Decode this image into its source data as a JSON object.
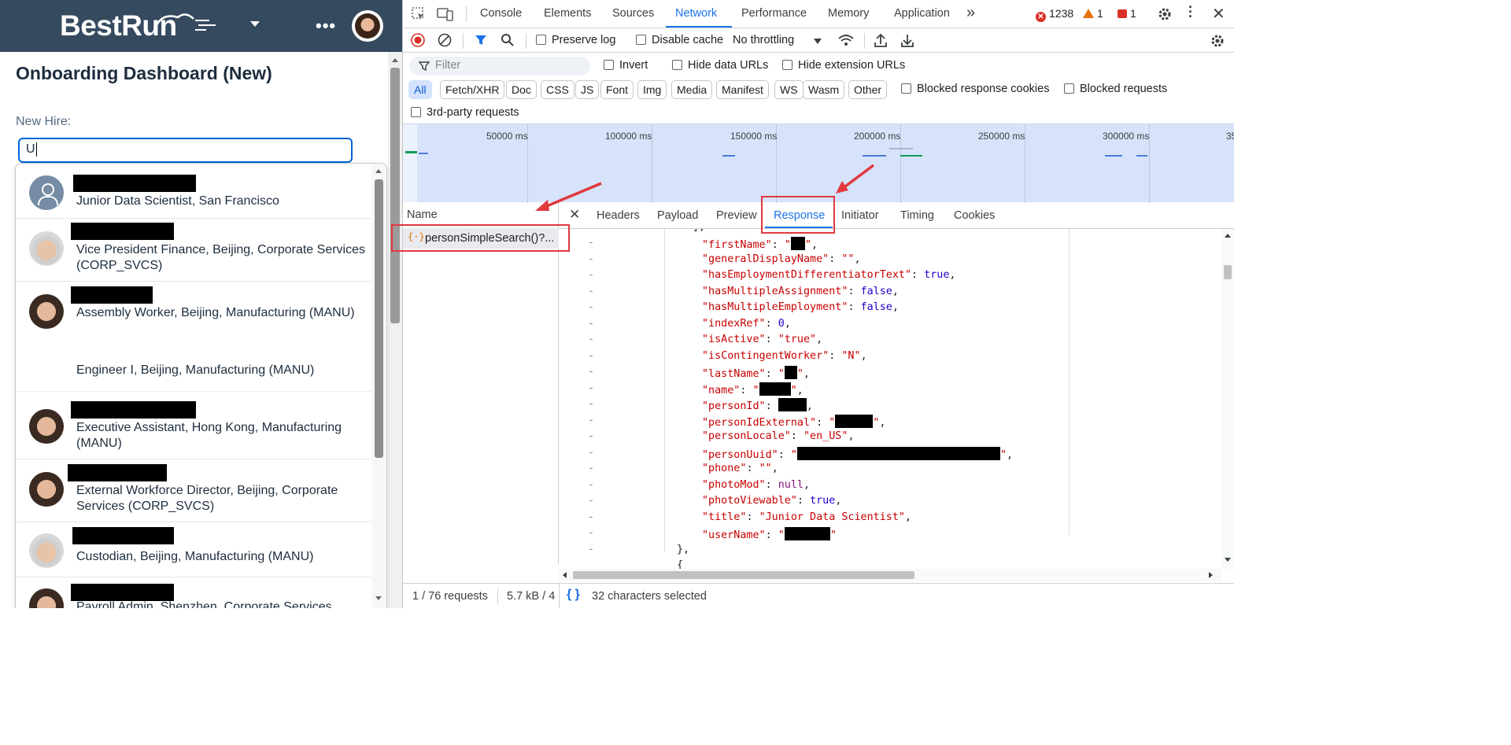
{
  "app": {
    "logo_text_best": "Best",
    "logo_text_run": "Run",
    "page_title": "Onboarding Dashboard (New)",
    "field_label": "New Hire:",
    "search_value": "U",
    "suggestions": [
      {
        "subtitle": "Junior Data Scientist, San Francisco"
      },
      {
        "subtitle": "Vice President Finance, Beijing, Corporate Services (CORP_SVCS)"
      },
      {
        "subtitle": "Assembly Worker, Beijing, Manufacturing (MANU)"
      },
      {
        "subtitle": "Engineer I, Beijing, Manufacturing (MANU)"
      },
      {
        "subtitle": "Executive Assistant, Hong Kong, Manufacturing (MANU)"
      },
      {
        "subtitle": "External Workforce Director, Beijing, Corporate Services (CORP_SVCS)"
      },
      {
        "subtitle": "Custodian, Beijing, Manufacturing (MANU)"
      },
      {
        "subtitle": "Payroll Admin, Shenzhen, Corporate Services"
      }
    ]
  },
  "devtools": {
    "tabs": [
      "Console",
      "Elements",
      "Sources",
      "Network",
      "Performance",
      "Memory",
      "Application"
    ],
    "active_tab": "Network",
    "more_tabs": "»",
    "counts": {
      "errors": "1238",
      "warnings": "1",
      "messages": "1"
    },
    "toolbar": {
      "preserve_log": "Preserve log",
      "disable_cache": "Disable cache",
      "throttling": "No throttling"
    },
    "filter": {
      "placeholder": "Filter",
      "invert": "Invert",
      "hide_data_urls": "Hide data URLs",
      "hide_extension_urls": "Hide extension URLs",
      "chips": [
        "All",
        "Fetch/XHR",
        "Doc",
        "CSS",
        "JS",
        "Font",
        "Img",
        "Media",
        "Manifest",
        "WS",
        "Wasm",
        "Other"
      ],
      "blocked_response_cookies": "Blocked response cookies",
      "blocked_requests": "Blocked requests",
      "third_party": "3rd-party requests"
    },
    "overview_ticks": [
      "50000 ms",
      "100000 ms",
      "150000 ms",
      "200000 ms",
      "250000 ms",
      "300000 ms",
      "35"
    ],
    "request_list": {
      "header": "Name",
      "selected_request": "personSimpleSearch()?..."
    },
    "detail_tabs": [
      "Headers",
      "Payload",
      "Preview",
      "Response",
      "Initiator",
      "Timing",
      "Cookies"
    ],
    "active_detail_tab": "Response",
    "response_lines": [
      {
        "indent": 4,
        "key": "firstName",
        "type": "str_redact"
      },
      {
        "indent": 4,
        "key": "generalDisplayName",
        "type": "str",
        "value": ""
      },
      {
        "indent": 4,
        "key": "hasEmploymentDifferentiatorText",
        "type": "bool",
        "value": "true"
      },
      {
        "indent": 4,
        "key": "hasMultipleAssignment",
        "type": "bool",
        "value": "false"
      },
      {
        "indent": 4,
        "key": "hasMultipleEmployment",
        "type": "bool",
        "value": "false"
      },
      {
        "indent": 4,
        "key": "indexRef",
        "type": "num",
        "value": "0"
      },
      {
        "indent": 4,
        "key": "isActive",
        "type": "str",
        "value": "true"
      },
      {
        "indent": 4,
        "key": "isContingentWorker",
        "type": "str",
        "value": "N"
      },
      {
        "indent": 4,
        "key": "lastName",
        "type": "str_redact"
      },
      {
        "indent": 4,
        "key": "name",
        "type": "str_redact"
      },
      {
        "indent": 4,
        "key": "personId",
        "type": "redact"
      },
      {
        "indent": 4,
        "key": "personIdExternal",
        "type": "str_redact"
      },
      {
        "indent": 4,
        "key": "personLocale",
        "type": "str",
        "value": "en_US"
      },
      {
        "indent": 4,
        "key": "personUuid",
        "type": "str_redact"
      },
      {
        "indent": 4,
        "key": "phone",
        "type": "str",
        "value": ""
      },
      {
        "indent": 4,
        "key": "photoMod",
        "type": "null",
        "value": "null"
      },
      {
        "indent": 4,
        "key": "photoViewable",
        "type": "bool",
        "value": "true"
      },
      {
        "indent": 4,
        "key": "title",
        "type": "str",
        "value": "Junior Data Scientist"
      },
      {
        "indent": 4,
        "key": "userName",
        "type": "str_redact_last"
      }
    ],
    "status": {
      "requests": "1 / 76 requests",
      "size": "5.7 kB / 4",
      "selection": "32 characters selected"
    }
  }
}
